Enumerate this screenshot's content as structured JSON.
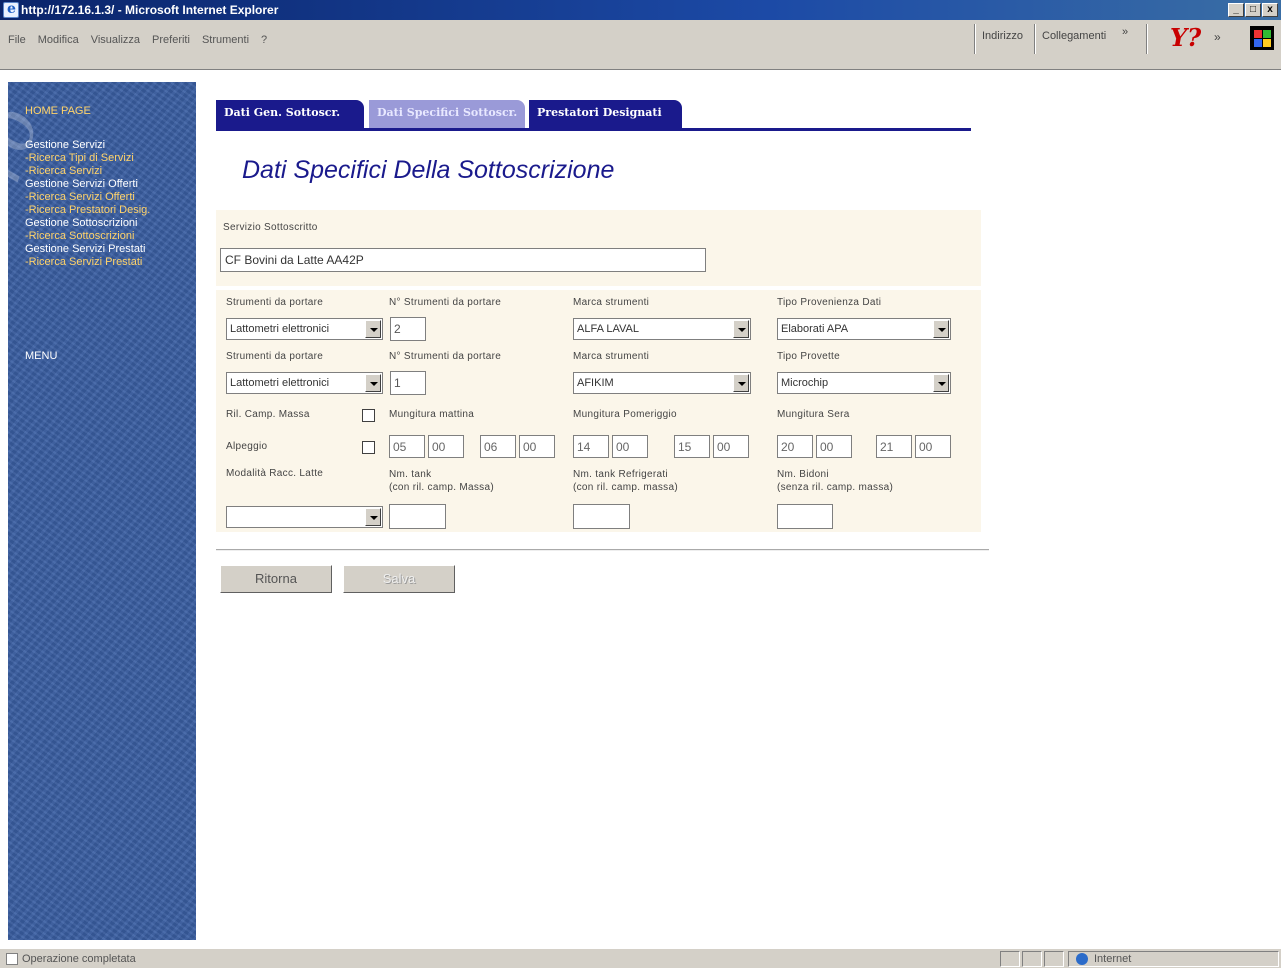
{
  "window": {
    "title": "http://172.16.1.3/ - Microsoft Internet Explorer",
    "controls": [
      "_",
      "□",
      "x"
    ]
  },
  "menubar": {
    "items": [
      "File",
      "Modifica",
      "Visualizza",
      "Preferiti",
      "Strumenti",
      "?"
    ],
    "address_label": "Indirizzo",
    "links_label": "Collegamenti",
    "chevron": "»",
    "yahoo_logo": "Y?",
    "chevron2": "»"
  },
  "sidebar": {
    "home": "HOME PAGE",
    "nav": [
      {
        "label": "Gestione Servizi",
        "kind": "head"
      },
      {
        "label": "-Ricerca Tipi di Servizi",
        "kind": "sub"
      },
      {
        "label": "-Ricerca Servizi",
        "kind": "sub"
      },
      {
        "label": "Gestione Servizi Offerti",
        "kind": "head"
      },
      {
        "label": "-Ricerca Servizi Offerti",
        "kind": "sub"
      },
      {
        "label": "-Ricerca Prestatori Desig.",
        "kind": "sub"
      },
      {
        "label": "Gestione Sottoscrizioni",
        "kind": "head"
      },
      {
        "label": "-Ricerca Sottoscrizioni",
        "kind": "sub"
      },
      {
        "label": "Gestione Servizi Prestati",
        "kind": "head"
      },
      {
        "label": "-Ricerca Servizi Prestati",
        "kind": "sub"
      }
    ],
    "menu": "MENU",
    "watermark": "Puma Pro"
  },
  "tabs": [
    {
      "label": "Dati Gen. Sottoscr.",
      "active": true
    },
    {
      "label": "Dati Specifici Sottoscr.",
      "active": false
    },
    {
      "label": "Prestatori Designati",
      "active": true
    }
  ],
  "page_title": "Dati Specifici Della Sottoscrizione",
  "form": {
    "servizio_label": "Servizio Sottoscritto",
    "servizio_value": "CF Bovini da Latte AA42P",
    "row1": {
      "strumenti_label": "Strumenti da portare",
      "strumenti_value": "Lattometri elettronici",
      "n_strumenti_label": "N° Strumenti da portare",
      "n_strumenti_value": "2",
      "marca_label": "Marca strumenti",
      "marca_value": "ALFA LAVAL",
      "tipo_label": "Tipo Provenienza Dati",
      "tipo_value": "Elaborati APA"
    },
    "row2": {
      "strumenti_label": "Strumenti da portare",
      "strumenti_value": "Lattometri elettronici",
      "n_strumenti_label": "N° Strumenti da portare",
      "n_strumenti_value": "1",
      "marca_label": "Marca strumenti",
      "marca_value": "AFIKIM",
      "tipo_label": "Tipo Provette",
      "tipo_value": "Microchip"
    },
    "ril_camp_label": "Ril. Camp. Massa",
    "alpeggio_label": "Alpeggio",
    "mattina_label": "Mungitura mattina",
    "pomeriggio_label": "Mungitura Pomeriggio",
    "sera_label": "Mungitura Sera",
    "mattina": [
      "05",
      "00",
      "06",
      "00"
    ],
    "pomeriggio": [
      "14",
      "00",
      "15",
      "00"
    ],
    "sera": [
      "20",
      "00",
      "21",
      "00"
    ],
    "modalita_label": "Modalità Racc. Latte",
    "modalita_value": "",
    "nm_tank_label1": "Nm. tank",
    "nm_tank_label2": "(con ril. camp. Massa)",
    "nm_tank_value": "",
    "nm_tank_refr_label1": "Nm. tank Refrigerati",
    "nm_tank_refr_label2": "(con ril. camp. massa)",
    "nm_tank_refr_value": "",
    "nm_bidoni_label1": "Nm. Bidoni",
    "nm_bidoni_label2": "(senza ril. camp. massa)",
    "nm_bidoni_value": ""
  },
  "buttons": {
    "ritorna": "Ritorna",
    "salva": "Salva"
  },
  "statusbar": {
    "text": "Operazione completata",
    "zone": "Internet"
  },
  "colors": {
    "tab_active": "#1a1a8c",
    "tab_inactive": "#9a9ad8",
    "sidebar_bg": "#3a5fa3",
    "nav_sub": "#ffd36a",
    "panel_bg": "#fbf6ea",
    "title": "#1a1a8c"
  }
}
